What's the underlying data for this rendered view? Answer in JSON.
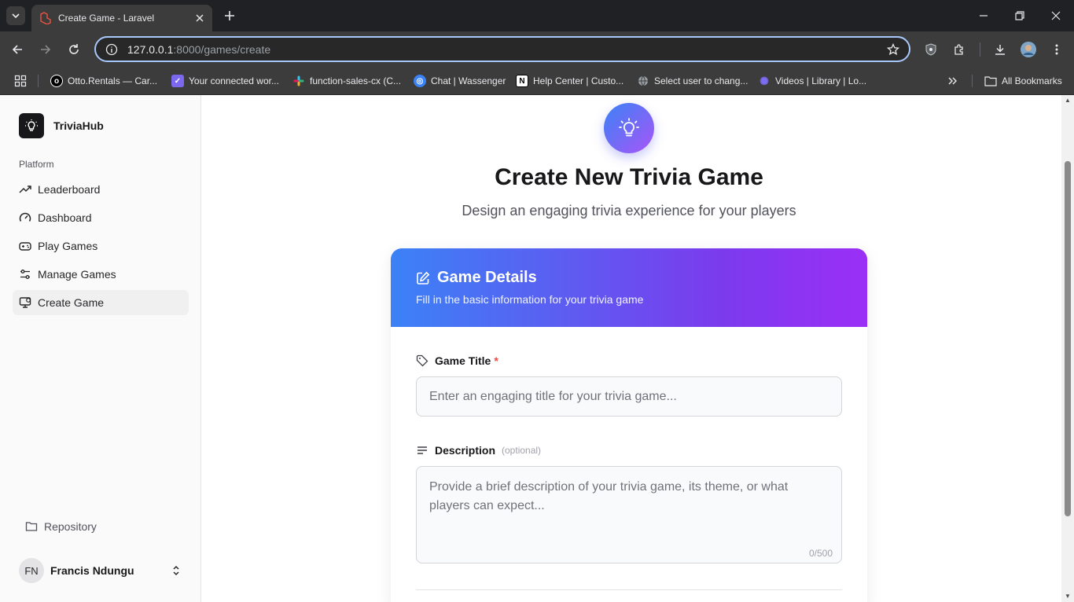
{
  "browser": {
    "tab_title": "Create Game - Laravel",
    "url_host": "127.0.0.1",
    "url_path": ":8000/games/create",
    "bookmarks": [
      {
        "label": "Otto.Rentals — Car...",
        "icon": "otto-icon"
      },
      {
        "label": "Your connected wor...",
        "icon": "clickup-icon"
      },
      {
        "label": "function-sales-cx (C...",
        "icon": "slack-icon"
      },
      {
        "label": "Chat | Wassenger",
        "icon": "chat-icon"
      },
      {
        "label": "Help Center | Custo...",
        "icon": "notion-icon"
      },
      {
        "label": "Select user to chang...",
        "icon": "globe-icon"
      },
      {
        "label": "Videos | Library | Lo...",
        "icon": "gear-icon"
      }
    ],
    "all_bookmarks": "All Bookmarks"
  },
  "sidebar": {
    "brand": "TriviaHub",
    "section": "Platform",
    "items": [
      {
        "label": "Leaderboard",
        "icon": "trending-up-icon",
        "active": false
      },
      {
        "label": "Dashboard",
        "icon": "gauge-icon",
        "active": false
      },
      {
        "label": "Play Games",
        "icon": "gamepad-icon",
        "active": false
      },
      {
        "label": "Manage Games",
        "icon": "sliders-icon",
        "active": false
      },
      {
        "label": "Create Game",
        "icon": "monitor-plus-icon",
        "active": true
      }
    ],
    "repository": "Repository",
    "user": {
      "initials": "FN",
      "name": "Francis Ndungu"
    }
  },
  "page": {
    "title": "Create New Trivia Game",
    "subtitle": "Design an engaging trivia experience for your players"
  },
  "card": {
    "title": "Game Details",
    "description": "Fill in the basic information for your trivia game",
    "game_title": {
      "label": "Game Title",
      "required_mark": "*",
      "value": "",
      "placeholder": "Enter an engaging title for your trivia game..."
    },
    "description_field": {
      "label": "Description",
      "optional": "(optional)",
      "value": "",
      "placeholder": "Provide a brief description of your trivia game, its theme, or what players can expect...",
      "counter": "0/500"
    }
  },
  "colors": {
    "accent_blue": "#3b82f6",
    "accent_purple": "#9b2ff6",
    "required": "#ef4444"
  }
}
